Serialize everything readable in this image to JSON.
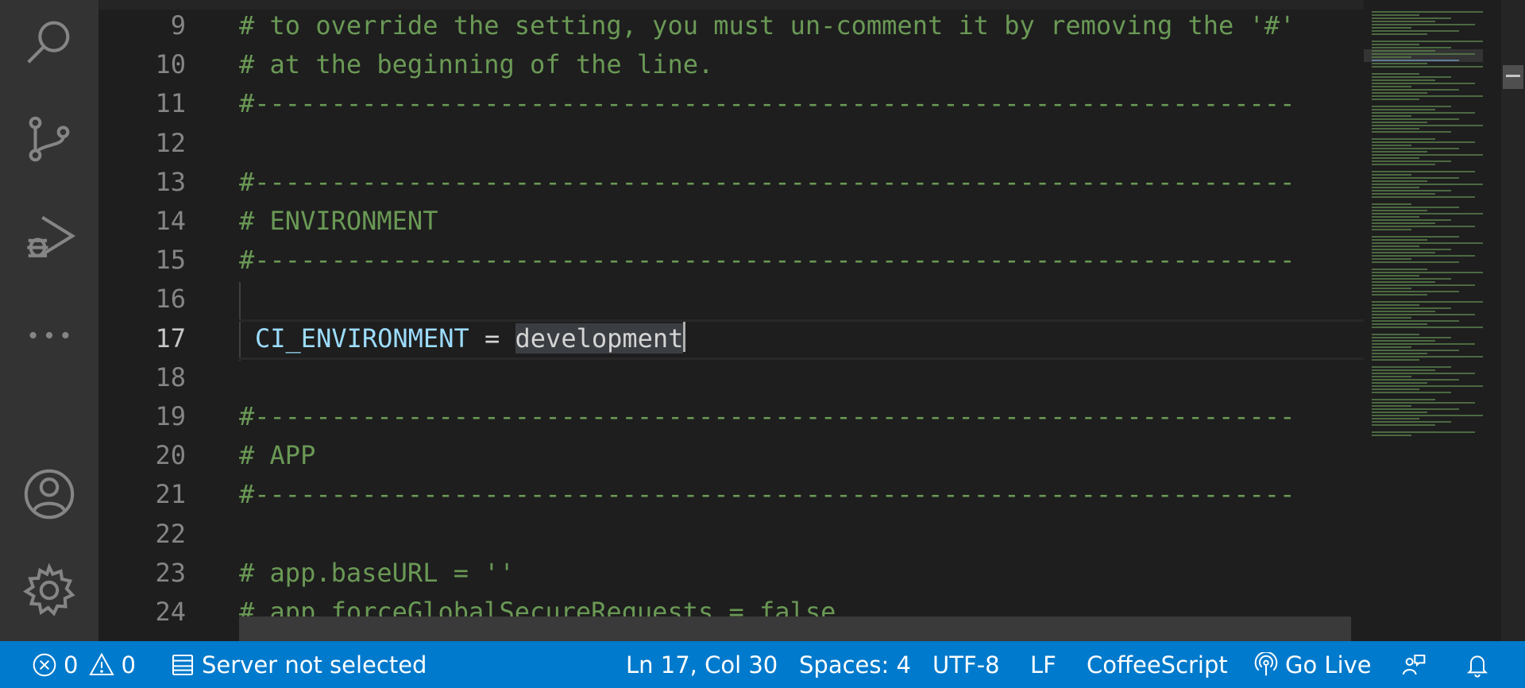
{
  "activity_bar": {
    "icons": [
      "search-icon",
      "source-control-icon",
      "run-debug-icon",
      "more-icon",
      "account-icon",
      "gear-icon"
    ]
  },
  "editor": {
    "language": "CoffeeScript",
    "lines": [
      {
        "n": "9",
        "text": "# to override the setting, you must un-comment it by removing the '#'"
      },
      {
        "n": "10",
        "text": "# at the beginning of the line."
      },
      {
        "n": "11",
        "text": "#--------------------------------------------------------------------"
      },
      {
        "n": "12",
        "text": ""
      },
      {
        "n": "13",
        "text": "#--------------------------------------------------------------------"
      },
      {
        "n": "14",
        "text": "# ENVIRONMENT"
      },
      {
        "n": "15",
        "text": "#--------------------------------------------------------------------"
      },
      {
        "n": "16",
        "text": ""
      },
      {
        "n": "17",
        "var": "CI_ENVIRONMENT",
        "op": " = ",
        "value": "development"
      },
      {
        "n": "18",
        "text": ""
      },
      {
        "n": "19",
        "text": "#--------------------------------------------------------------------"
      },
      {
        "n": "20",
        "text": "# APP"
      },
      {
        "n": "21",
        "text": "#--------------------------------------------------------------------"
      },
      {
        "n": "22",
        "text": ""
      },
      {
        "n": "23",
        "text": "# app.baseURL = ''"
      },
      {
        "n": "24",
        "text": "# app.forceGlobalSecureRequests = false"
      }
    ]
  },
  "status_bar": {
    "errors": "0",
    "warnings": "0",
    "server": "Server not selected",
    "position": "Ln 17, Col 30",
    "spaces": "Spaces: 4",
    "encoding": "UTF-8",
    "eol": "LF",
    "language": "CoffeeScript",
    "go_live": "Go Live"
  },
  "colors": {
    "status_bar": "#007acc",
    "comment": "#6a9955",
    "variable": "#9cdcfe",
    "editor_bg": "#1e1e1e",
    "activity_bar": "#333333"
  }
}
